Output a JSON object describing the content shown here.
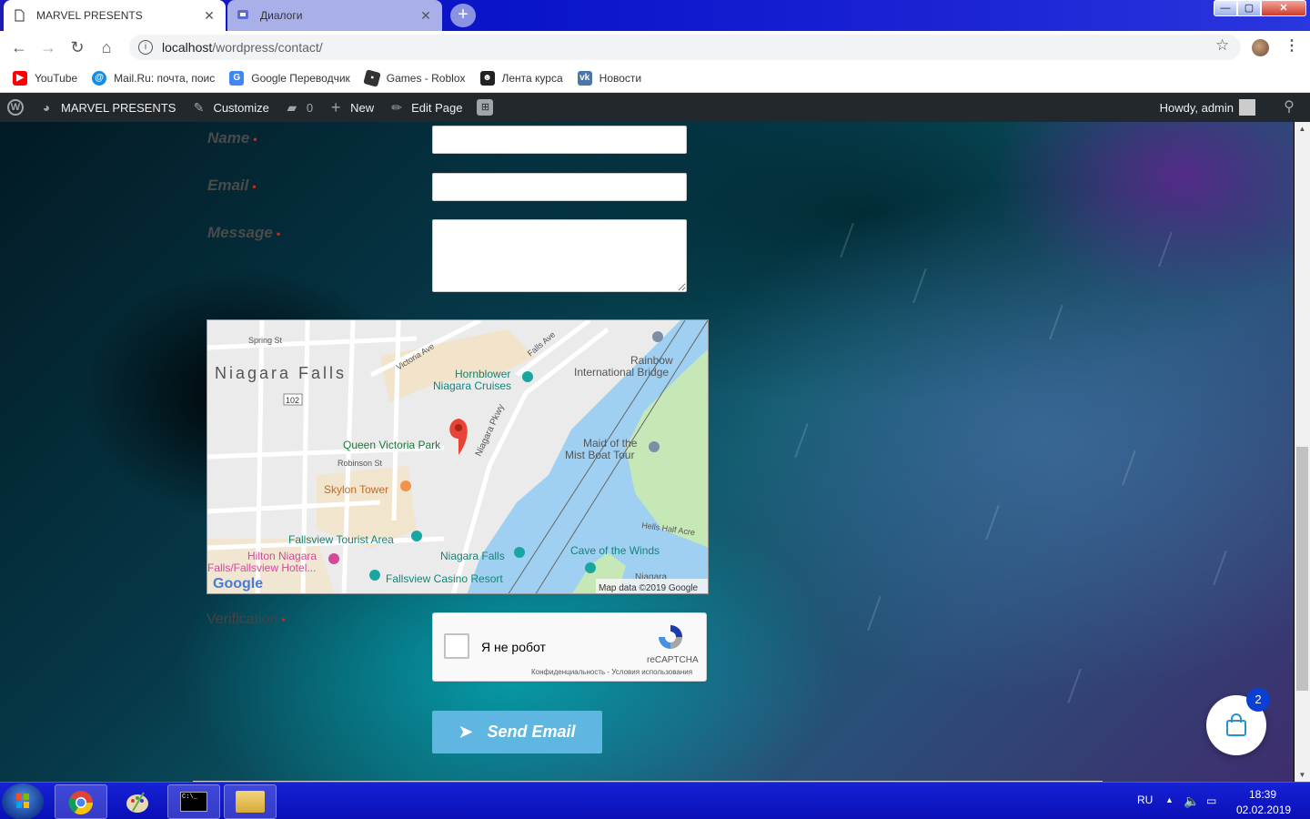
{
  "browser": {
    "tabs": [
      {
        "title": "MARVEL PRESENTS",
        "active": true
      },
      {
        "title": "Диалоги",
        "active": false
      }
    ],
    "new_tab": "+",
    "window_controls": {
      "minimize": "—",
      "maximize": "▢",
      "close": "✕"
    },
    "address": {
      "host": "localhost",
      "path": "/wordpress/contact/"
    },
    "bookmarks": [
      {
        "label": "YouTube",
        "icon": "youtube-icon",
        "color": "#ff0000"
      },
      {
        "label": "Mail.Ru: почта, поис",
        "icon": "mailru-icon",
        "color": "#168de2"
      },
      {
        "label": "Google Переводчик",
        "icon": "google-translate-icon",
        "color": "#4285f4"
      },
      {
        "label": "Games - Roblox",
        "icon": "roblox-icon",
        "color": "#333333"
      },
      {
        "label": "Лента курса",
        "icon": "course-icon",
        "color": "#222222"
      },
      {
        "label": "Новости",
        "icon": "vk-icon",
        "color": "#4a76a8"
      }
    ]
  },
  "wp_admin_bar": {
    "site_name": "MARVEL PRESENTS",
    "customize": "Customize",
    "comments_count": "0",
    "new": "New",
    "edit_page": "Edit Page",
    "howdy": "Howdy, admin"
  },
  "form": {
    "name_label": "Name",
    "email_label": "Email",
    "message_label": "Message",
    "required_mark": "•",
    "verification_label": "Verification",
    "captcha_text": "Я не робот",
    "captcha_brand": "reCAPTCHA",
    "captcha_terms": "Конфиденциальность - Условия использования",
    "send_label": "Send Email"
  },
  "map": {
    "city": "Niagara Falls",
    "labels": {
      "spring_st": "Spring St",
      "victoria_ave": "Victoria Ave",
      "falls_ave": "Falls Ave",
      "rainbow_bridge": [
        "Rainbow",
        "International Bridge"
      ],
      "hornblower": [
        "Hornblower",
        "Niagara Cruises"
      ],
      "route": "102",
      "queen_victoria_park": "Queen Victoria Park",
      "niagara_pkwy": "Niagara Pkwy",
      "robinson_st": "Robinson St",
      "maid_of_mist": [
        "Maid of the",
        "Mist Boat Tour"
      ],
      "skylon": "Skylon Tower",
      "hells_half_acre": "Hells Half Acre",
      "fallsview_tourist": "Fallsview Tourist Area",
      "hilton": [
        "Hilton Niagara",
        "Falls/Fallsview Hotel..."
      ],
      "niagara_falls_poi": "Niagara Falls",
      "cave_of_winds": "Cave of the Winds",
      "fallsview_casino": "Fallsview Casino Resort",
      "niagara_partial": "Niagara",
      "google": "Google",
      "map_data": "Map data ©2019 Google"
    }
  },
  "cart": {
    "count": "2"
  },
  "taskbar": {
    "lang": "RU",
    "time": "18:39",
    "date": "02.02.2019"
  }
}
